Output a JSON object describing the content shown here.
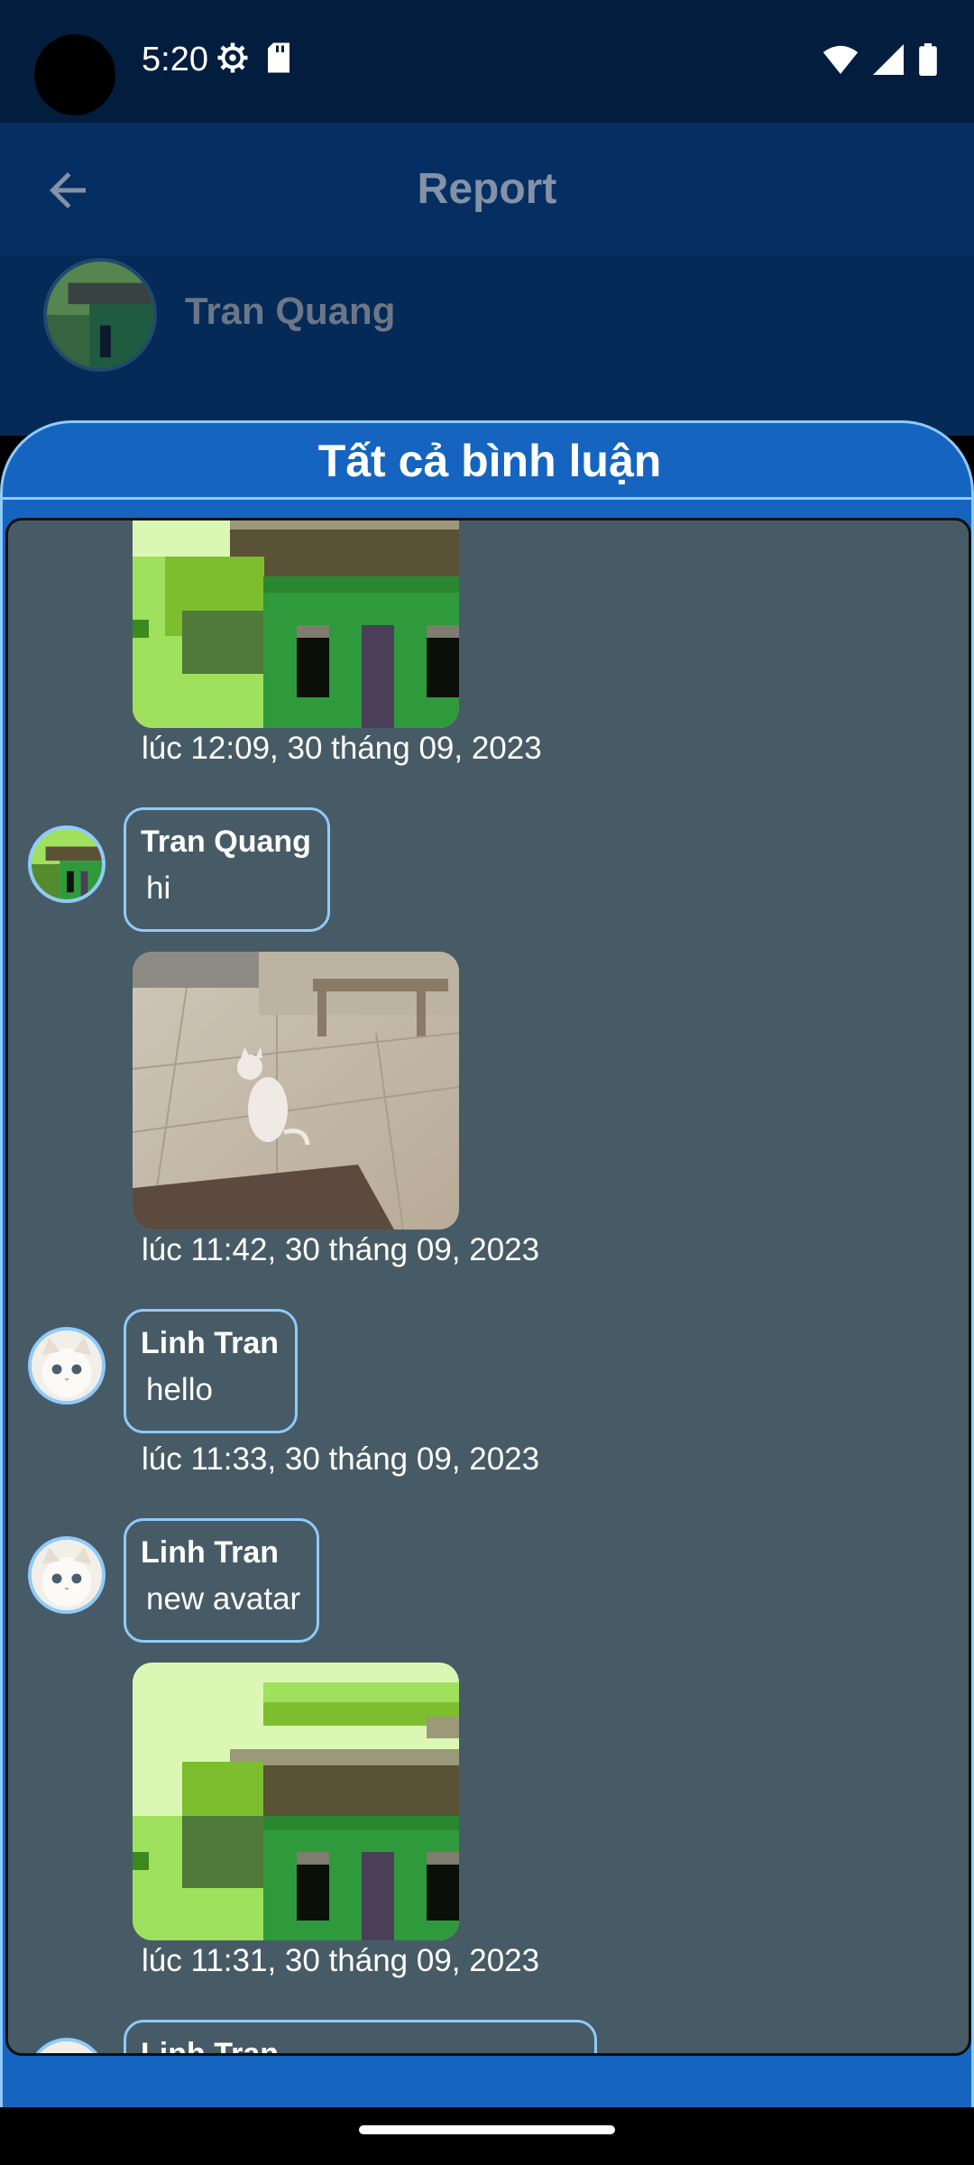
{
  "status_bar": {
    "time": "5:20",
    "icons_left": [
      "gear-icon",
      "sdcard-icon"
    ],
    "icons_right": [
      "wifi-icon",
      "signal-icon",
      "battery-icon"
    ]
  },
  "app_bar": {
    "title": "Report"
  },
  "background": {
    "username": "Tran Quang"
  },
  "sheet": {
    "title": "Tất cả bình luận"
  },
  "comments": [
    {
      "type": "image-only",
      "image": "house-pixel-image",
      "timestamp": "lúc 12:09, 30 tháng 09, 2023"
    },
    {
      "name": "Tran Quang",
      "text": "hi",
      "avatar": "house-pixel-avatar",
      "image": "cat-photo-image",
      "timestamp": "lúc 11:42, 30 tháng 09, 2023"
    },
    {
      "name": "Linh Tran",
      "text": "hello",
      "avatar": "cat-avatar",
      "timestamp": "lúc 11:33, 30 tháng 09, 2023"
    },
    {
      "name": "Linh Tran",
      "text": "new avatar",
      "avatar": "cat-avatar",
      "image": "house-pixel-image",
      "timestamp": "lúc 11:31, 30 tháng 09, 2023"
    },
    {
      "name": "Linh Tran",
      "text": "",
      "avatar": "cat-avatar"
    }
  ],
  "colors": {
    "status_bar_bg": "#031d3f",
    "app_bar_bg": "#052f63",
    "sheet_bg": "#1565c0",
    "sheet_border": "#90caf9",
    "panel_bg": "#475b66"
  }
}
